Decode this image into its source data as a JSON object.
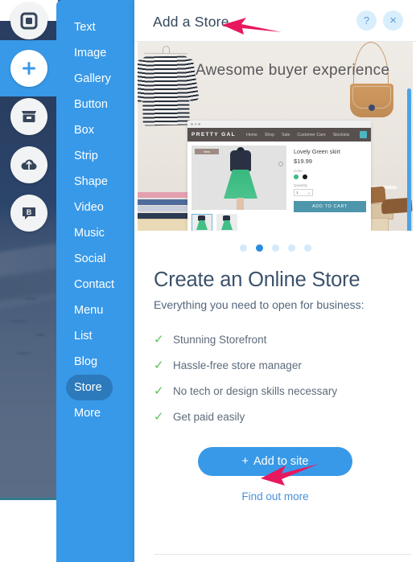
{
  "rail": {
    "items": [
      {
        "name": "pages-icon",
        "label": "Pages"
      },
      {
        "name": "add-icon",
        "label": "Add"
      },
      {
        "name": "store-icon",
        "label": "Store"
      },
      {
        "name": "upload-icon",
        "label": "Upload"
      },
      {
        "name": "blog-icon",
        "label": "Blog"
      }
    ]
  },
  "menu": {
    "items": [
      {
        "label": "Text",
        "selected": false
      },
      {
        "label": "Image",
        "selected": false
      },
      {
        "label": "Gallery",
        "selected": false
      },
      {
        "label": "Button",
        "selected": false
      },
      {
        "label": "Box",
        "selected": false
      },
      {
        "label": "Strip",
        "selected": false
      },
      {
        "label": "Shape",
        "selected": false
      },
      {
        "label": "Video",
        "selected": false
      },
      {
        "label": "Music",
        "selected": false
      },
      {
        "label": "Social",
        "selected": false
      },
      {
        "label": "Contact",
        "selected": false
      },
      {
        "label": "Menu",
        "selected": false
      },
      {
        "label": "List",
        "selected": false
      },
      {
        "label": "Blog",
        "selected": false
      },
      {
        "label": "Store",
        "selected": true
      },
      {
        "label": "More",
        "selected": false
      }
    ],
    "accent": "#3899e8",
    "selected_bg": "#2c7abc"
  },
  "panel": {
    "title": "Add a Store",
    "help_label": "?",
    "close_label": "×"
  },
  "hero": {
    "caption": "Awesome buyer experience",
    "mock": {
      "brand": "PRETTY GAL",
      "nav": [
        "Home",
        "Shop",
        "Sale",
        "Customer Care",
        "Stockists"
      ],
      "badge": "New",
      "product_title": "Lovely Green skirt",
      "price": "$19.99",
      "color_label": "Color",
      "colors": [
        "#3cba84",
        "#1a1a1a"
      ],
      "quantity_label": "Quantity",
      "quantity_value": "1",
      "quantity_caret": "⌄",
      "cart_button": "ADD TO CART"
    }
  },
  "carousel": {
    "count": 5,
    "active_index": 1
  },
  "main": {
    "heading": "Create an Online Store",
    "subtitle": "Everything you need to open for business:",
    "check_glyph": "✓",
    "features": [
      "Stunning Storefront",
      "Hassle-free store manager",
      "No tech or design skills necessary",
      "Get paid easily"
    ],
    "cta_plus": "+",
    "cta_label": "Add to site",
    "find_out_more": "Find out more"
  },
  "annotations": {
    "arrow_color": "#E8185E",
    "arrow_title_target": "Add a Store",
    "arrow_cta_target": "Add to site"
  }
}
